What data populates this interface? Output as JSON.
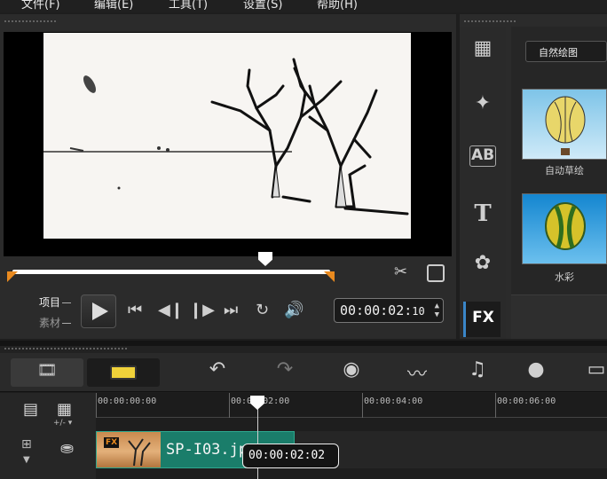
{
  "menu": [
    "文件(F)",
    "编辑(E)",
    "工具(T)",
    "设置(S)",
    "帮助(H)"
  ],
  "player": {
    "mode_project": "项目",
    "mode_clip": "素材",
    "timecode": "00:00:02:",
    "timecode_frames": "10",
    "scrub_position": 0.8
  },
  "library": {
    "category": "自然绘图",
    "filters": [
      {
        "label": "自动草绘",
        "thumb": "balloon-blue-sky"
      },
      {
        "label": "水彩",
        "thumb": "balloon-watercolor"
      }
    ],
    "fx_label": "FX"
  },
  "timeline": {
    "ticks": [
      "00:00:00:00",
      "00:00:02:00",
      "00:00:04:00",
      "00:00:06:00"
    ],
    "clip": {
      "name": "SP-I03.jp",
      "fx": "FX"
    },
    "tooltip": "00:00:02:02",
    "zoom_label": "+/-"
  },
  "colors": {
    "accent": "#e98a1f",
    "clip": "#1a7d6a",
    "fx_selected": "#3a86c8"
  }
}
